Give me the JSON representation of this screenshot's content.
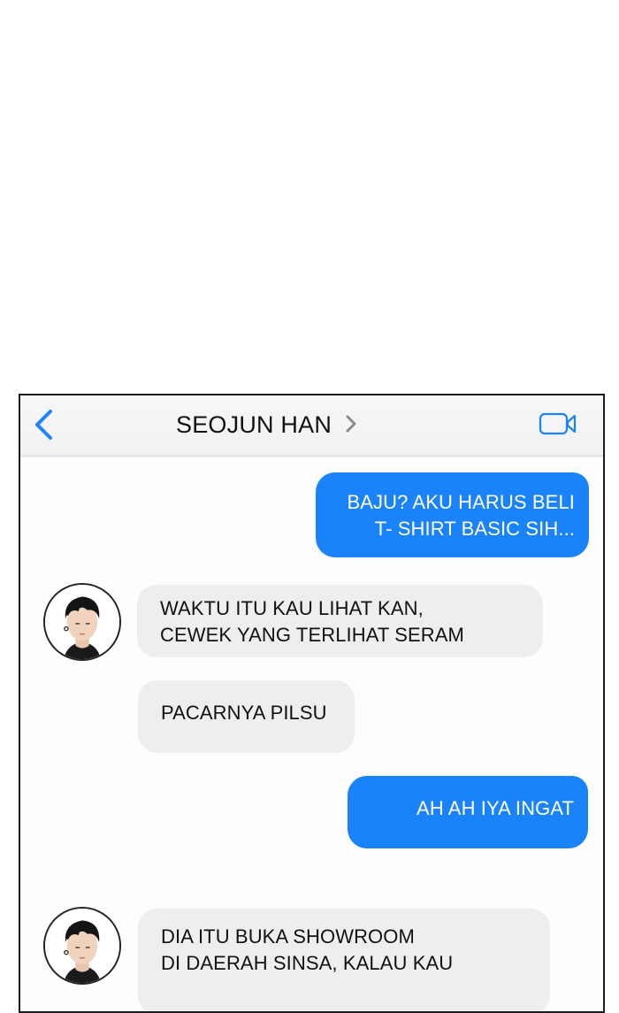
{
  "header": {
    "contact_name": "SEOJUN HAN",
    "back_icon": "chevron-left-icon",
    "chevron_icon": "chevron-right-icon",
    "video_icon": "video-camera-icon",
    "accent_color": "#1a83f9"
  },
  "messages": [
    {
      "direction": "outgoing",
      "lines": [
        "BAJU? AKU HARUS BELI",
        "T- SHIRT BASIC SIH..."
      ]
    },
    {
      "direction": "incoming",
      "lines": [
        "WAKTU ITU KAU LIHAT KAN,",
        "CEWEK YANG TERLIHAT SERAM"
      ]
    },
    {
      "direction": "incoming",
      "lines": [
        "PACARNYA PILSU"
      ]
    },
    {
      "direction": "outgoing",
      "lines": [
        "AH AH IYA INGAT"
      ]
    },
    {
      "direction": "incoming",
      "lines": [
        "DIA ITU BUKA SHOWROOM",
        "DI DAERAH SINSA,  KALAU KAU"
      ]
    }
  ],
  "colors": {
    "outgoing_bubble": "#1a83f9",
    "incoming_bubble": "#eeeeee",
    "header_background": "#f4f4f4"
  }
}
